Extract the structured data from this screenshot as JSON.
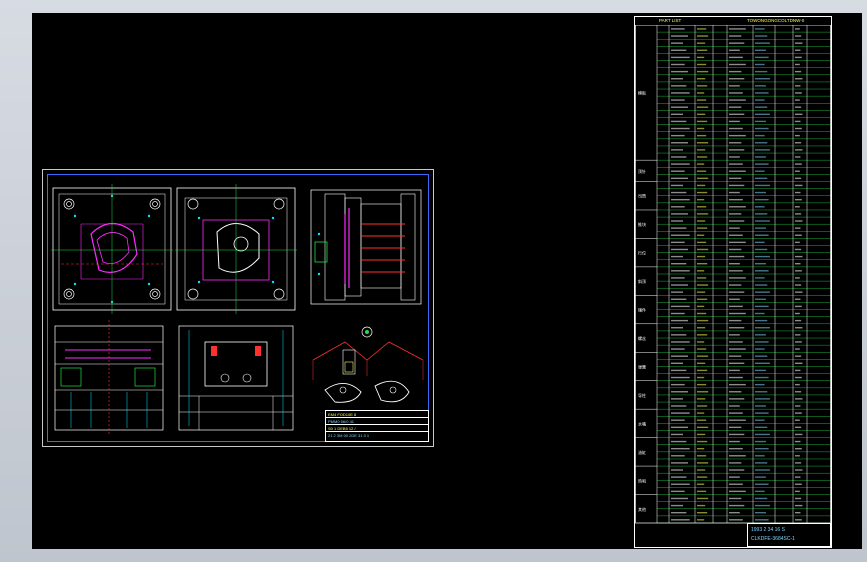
{
  "app": {
    "viewport": "model-space"
  },
  "drawing": {
    "title_block": {
      "rows": [
        "EM4 FOD10E 8",
        "PMM0 56/0 41",
        "S0 1 DEB5 12 /",
        "21 2 3M 00 2DE  31  0 1"
      ]
    },
    "parts_label_left": "1001"
  },
  "bom": {
    "header_left": "PART LIST",
    "header_right": "TOWONGONGCOLTDNW-0",
    "groups": [
      "模板",
      "顶针",
      "司筒",
      "推块",
      "行位",
      "斜顶",
      "镶件",
      "螺丝",
      "弹簧",
      "导柱",
      "水嘴",
      "油缸",
      "热咀",
      "其他"
    ],
    "row_count": 70,
    "title_block": {
      "line1": "1993 2 34 16 S",
      "line2": "CLKDFE-3684SC-1"
    }
  },
  "colors": {
    "canvas_bg": "#000000",
    "cad_white": "#ffffff",
    "cad_magenta": "#ff2bff",
    "cad_cyan": "#00e5ff",
    "cad_green": "#22dd44",
    "cad_red": "#ff3030",
    "cad_yellow": "#ffff55",
    "cad_blue": "#3a6bff"
  }
}
